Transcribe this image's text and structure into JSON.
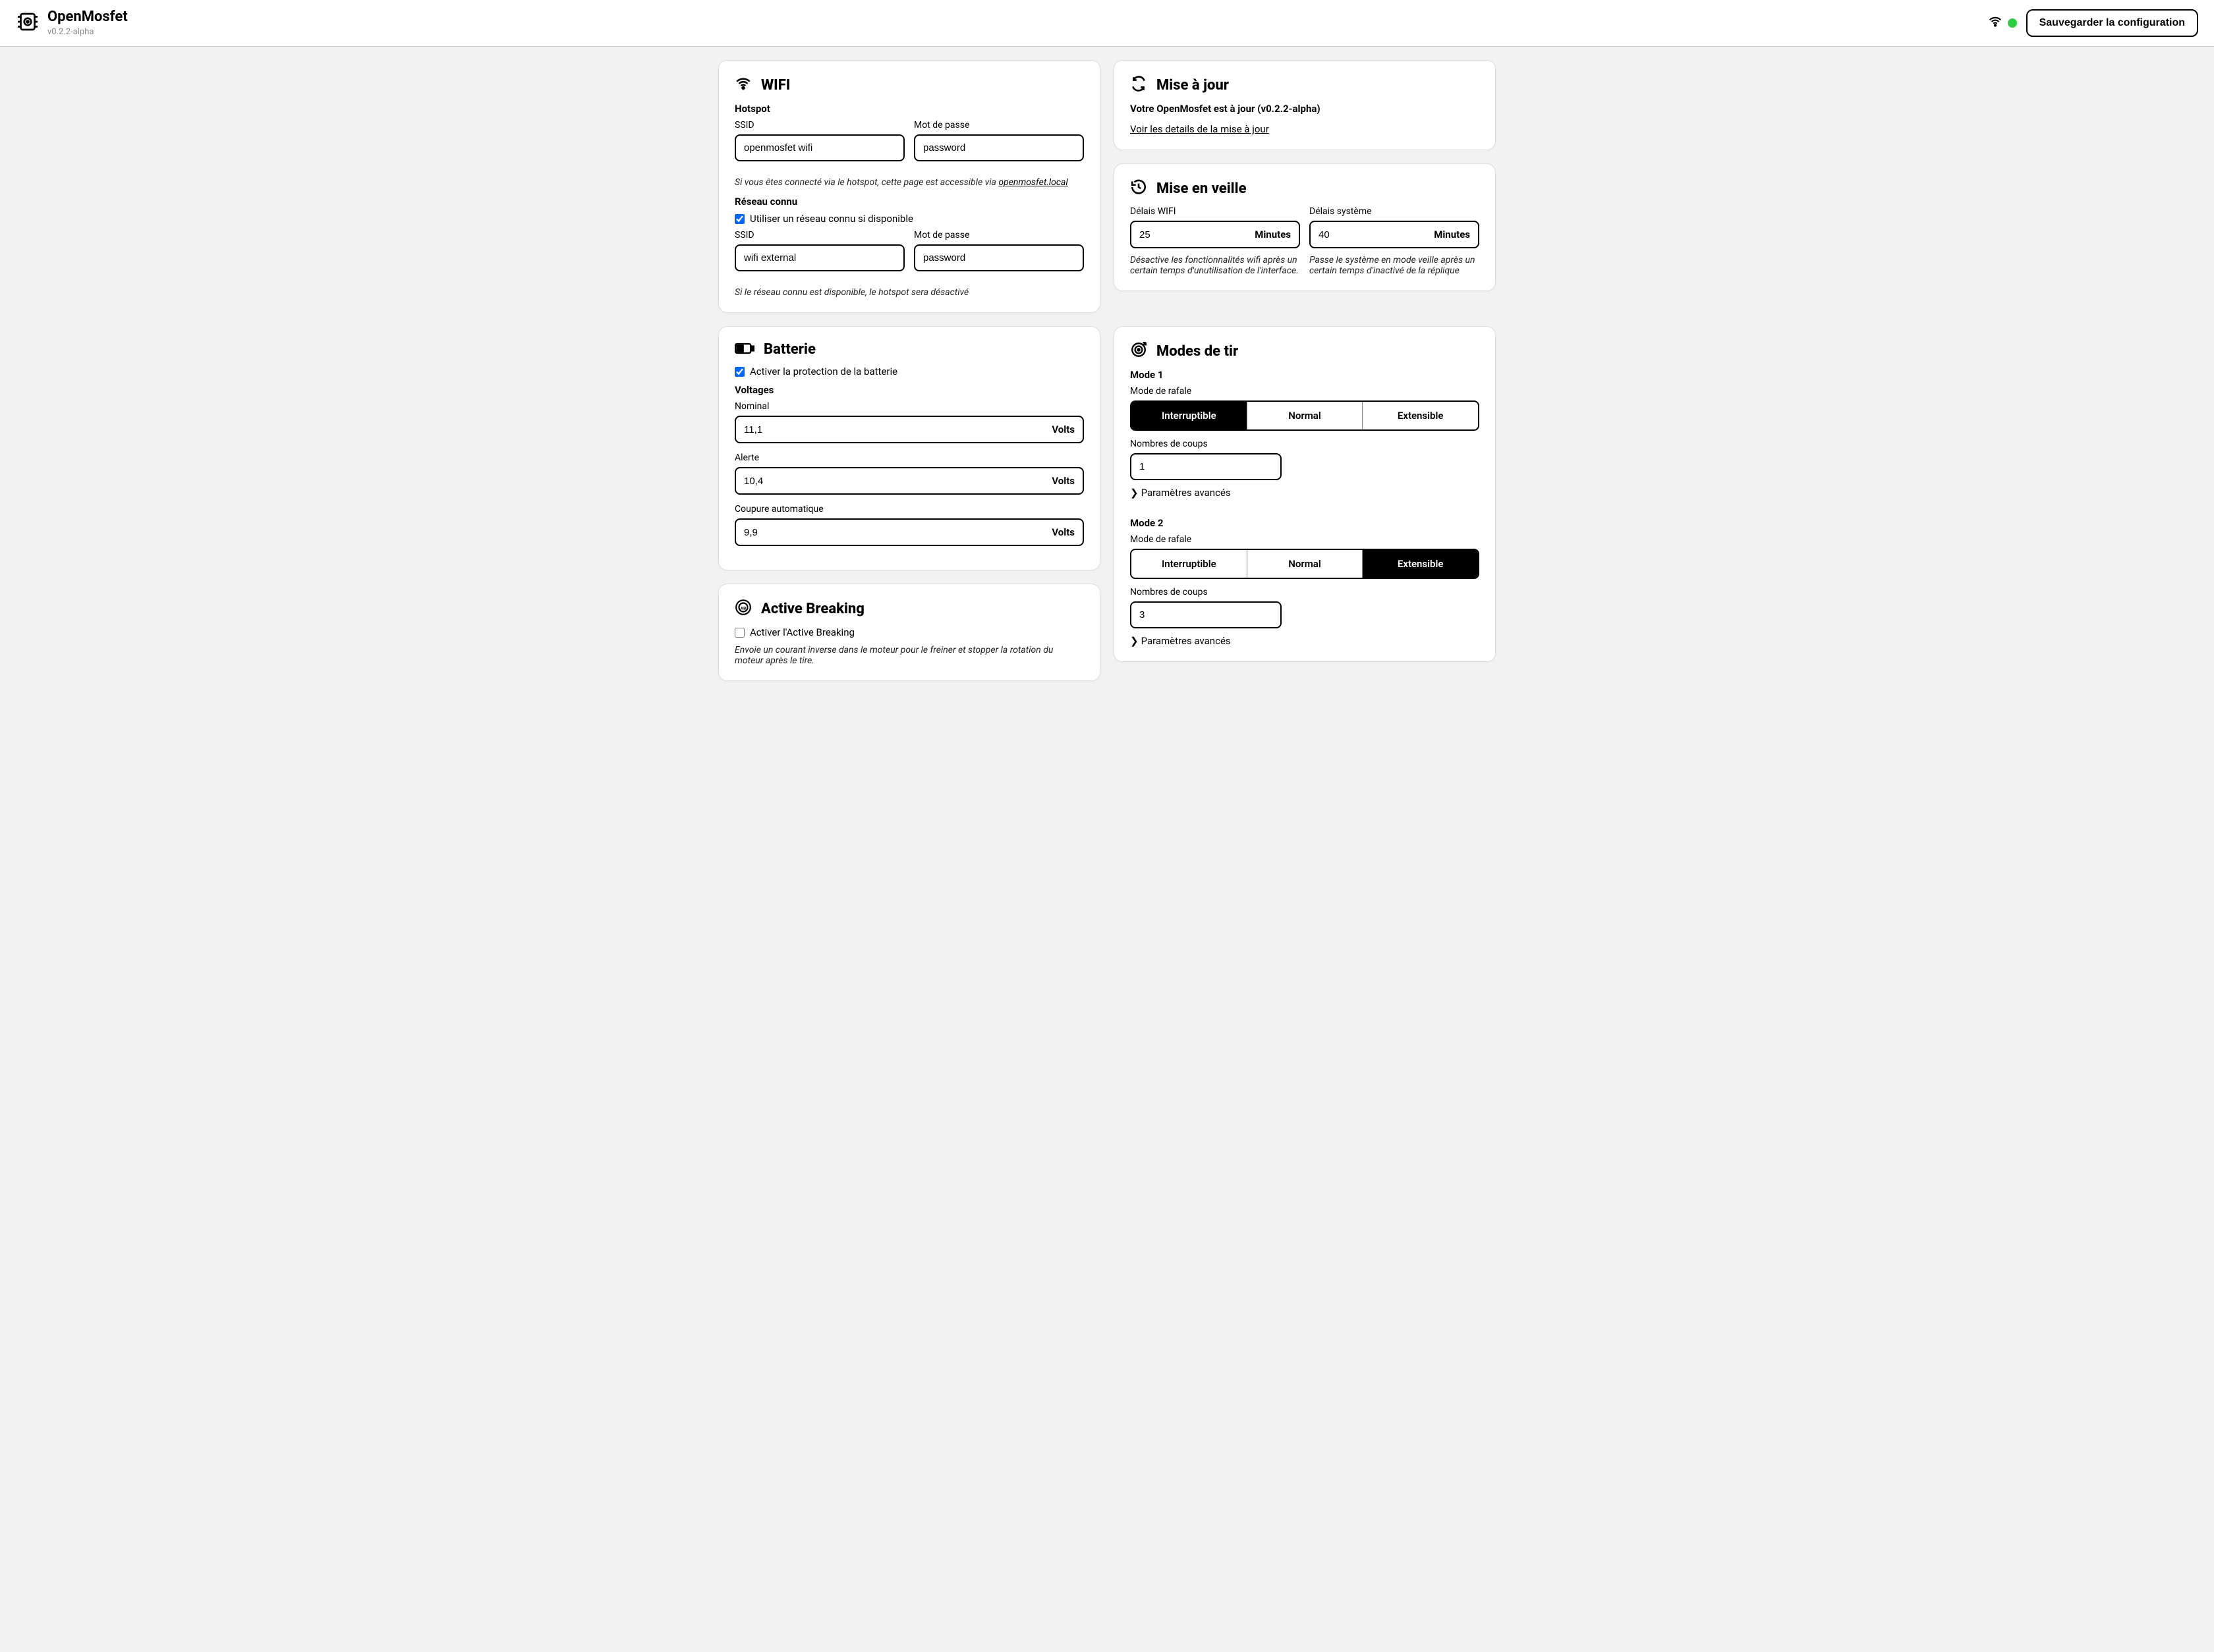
{
  "app": {
    "name": "OpenMosfet",
    "version": "v0.2.2-alpha"
  },
  "topbar": {
    "save_label": "Sauvegarder la configuration"
  },
  "wifi": {
    "title": "WIFI",
    "hotspot_heading": "Hotspot",
    "ssid_label": "SSID",
    "password_label": "Mot de passe",
    "hotspot_ssid": "openmosfet wifi",
    "hotspot_password": "password",
    "hotspot_hint_pre": "Si vous êtes connecté via le hotspot, cette page est accessible via ",
    "hotspot_hint_link": "openmosfet.local",
    "known_heading": "Réseau connu",
    "use_known_label": "Utiliser un réseau connu si disponible",
    "known_ssid": "wifi external",
    "known_password": "password",
    "known_hint": "Si le réseau connu est disponible, le hotspot sera désactivé"
  },
  "update": {
    "title": "Mise à jour",
    "status": "Votre OpenMosfet est à jour (v0.2.2-alpha)",
    "details_link": "Voir les details de la mise à jour"
  },
  "sleep": {
    "title": "Mise en veille",
    "wifi_label": "Délais WIFI",
    "wifi_value": "25",
    "system_label": "Délais système",
    "system_value": "40",
    "unit": "Minutes",
    "wifi_hint": "Désactive les fonctionnalités wifi après un certain temps d'unutilisation de l'interface.",
    "system_hint": "Passe le système en mode veille après un certain temps d'inactivé de la réplique"
  },
  "battery": {
    "title": "Batterie",
    "protect_label": "Activer la protection de la batterie",
    "voltages_heading": "Voltages",
    "nominal_label": "Nominal",
    "nominal_value": "11,1",
    "alert_label": "Alerte",
    "alert_value": "10,4",
    "cutoff_label": "Coupure automatique",
    "cutoff_value": "9,9",
    "unit": "Volts"
  },
  "ab": {
    "title": "Active Breaking",
    "enable_label": "Activer l'Active Breaking",
    "hint": "Envoie un courant inverse dans le moteur pour le freiner et stopper la rotation du moteur après le tire."
  },
  "fire": {
    "title": "Modes de tir",
    "burst_label": "Mode de rafale",
    "shots_label": "Nombres de coups",
    "advanced_label": "Paramètres avancés",
    "seg": {
      "interruptible": "Interruptible",
      "normal": "Normal",
      "extensible": "Extensible"
    },
    "mode1": {
      "heading": "Mode 1",
      "shots": "1"
    },
    "mode2": {
      "heading": "Mode 2",
      "shots": "3"
    }
  }
}
